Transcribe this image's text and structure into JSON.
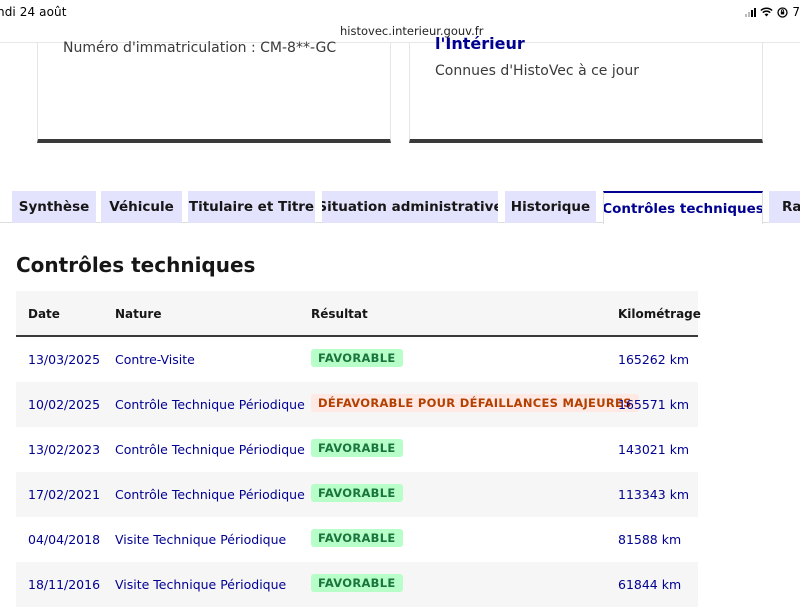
{
  "status_bar": {
    "time": "ndi 24 août",
    "battery": "7"
  },
  "browser": {
    "url": "histovec.interieur.gouv.fr"
  },
  "cards": {
    "left": {
      "plate_label": "Numéro d'immatriculation : CM-8**-GC"
    },
    "right": {
      "title": "l'Intérieur",
      "subtitle": "Connues d'HistoVec à ce jour"
    }
  },
  "tabs": [
    {
      "label": "Synthèse",
      "active": false
    },
    {
      "label": "Véhicule",
      "active": false
    },
    {
      "label": "Titulaire et Titre",
      "active": false
    },
    {
      "label": "Situation administrative",
      "active": false
    },
    {
      "label": "Historique",
      "active": false
    },
    {
      "label": "Contrôles techniques",
      "active": true
    },
    {
      "label": "Rap",
      "active": false
    }
  ],
  "section": {
    "title": "Contrôles techniques"
  },
  "table": {
    "headers": {
      "date": "Date",
      "nature": "Nature",
      "result": "Résultat",
      "km": "Kilométrage"
    },
    "rows": [
      {
        "date": "13/03/2025",
        "nature": "Contre-Visite",
        "result": "FAVORABLE",
        "status": "ok",
        "km": "165262 km"
      },
      {
        "date": "10/02/2025",
        "nature": "Contrôle Technique Périodique",
        "result": "DÉFAVORABLE POUR DÉFAILLANCES MAJEURES",
        "status": "ko",
        "km": "165571 km"
      },
      {
        "date": "13/02/2023",
        "nature": "Contrôle Technique Périodique",
        "result": "FAVORABLE",
        "status": "ok",
        "km": "143021 km"
      },
      {
        "date": "17/02/2021",
        "nature": "Contrôle Technique Périodique",
        "result": "FAVORABLE",
        "status": "ok",
        "km": "113343 km"
      },
      {
        "date": "04/04/2018",
        "nature": "Visite Technique Périodique",
        "result": "FAVORABLE",
        "status": "ok",
        "km": "81588 km"
      },
      {
        "date": "18/11/2016",
        "nature": "Visite Technique Périodique",
        "result": "FAVORABLE",
        "status": "ok",
        "km": "61844 km"
      }
    ]
  },
  "colors": {
    "brand_blue": "#000091",
    "tab_bg": "#e3e3fd",
    "success_bg": "#b8fec9",
    "success_text": "#18753c",
    "error_bg": "#fee9e5",
    "error_text": "#b34000"
  }
}
